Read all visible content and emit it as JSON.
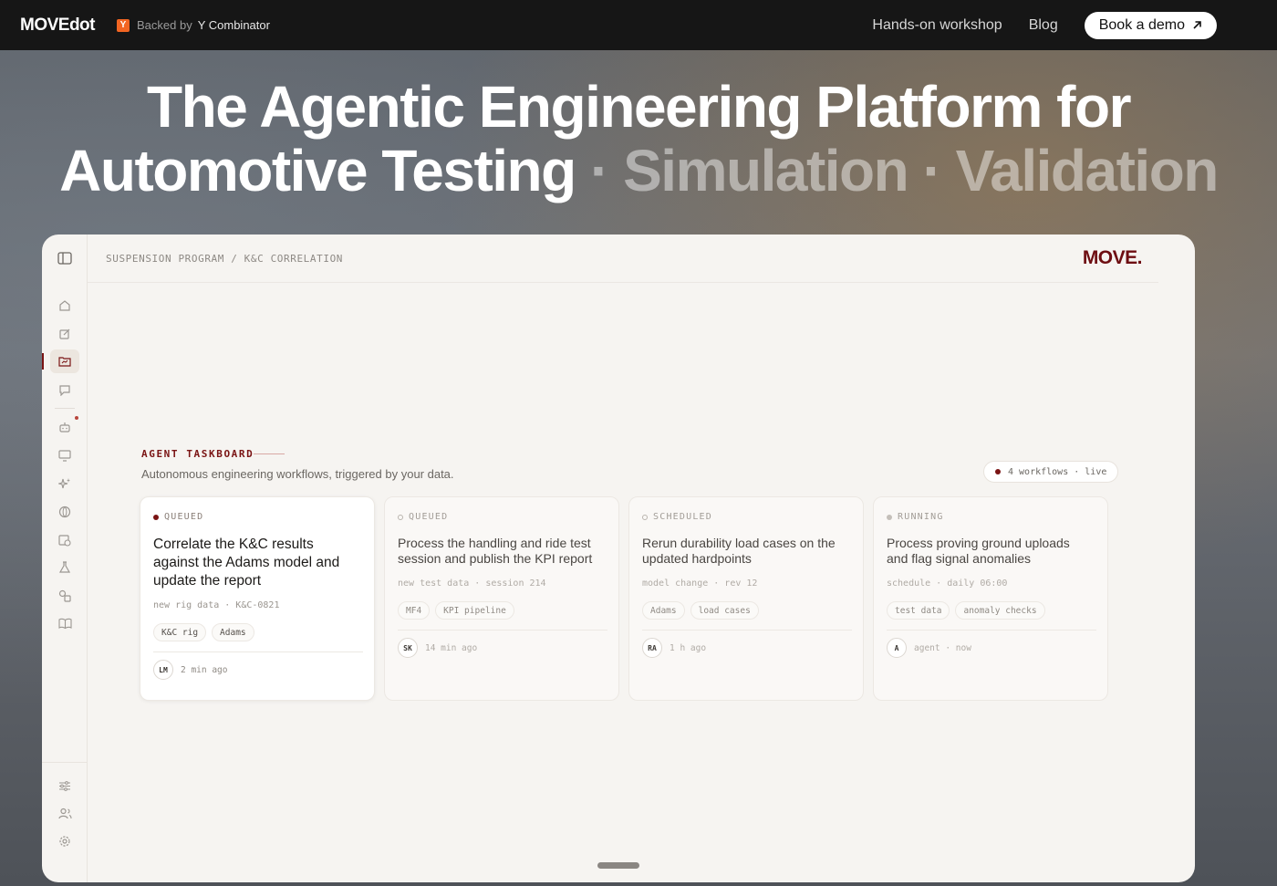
{
  "topbar": {
    "brand": "MOVEdot",
    "yc_letter": "Y",
    "backed_by": "Backed by",
    "yc_name": "Y Combinator",
    "links": [
      "Hands-on workshop",
      "Blog"
    ],
    "demo_label": "Book a demo",
    "demo_icon": "arrow-up-right-icon"
  },
  "hero": {
    "line1": "The Agentic Engineering Platform for",
    "line2_main": "Automotive Testing",
    "line2_sep1": " · ",
    "line2_dim1": "Simulation",
    "line2_sep2": " · ",
    "line2_dim2": "Validation"
  },
  "app": {
    "breadcrumb": "SUSPENSION PROGRAM / K&C CORRELATION",
    "logo": "MOVE.",
    "accent": "#7a1414",
    "taskboard": {
      "title": "AGENT TASKBOARD",
      "subtitle": "Autonomous engineering workflows, triggered by your data.",
      "live_pill": "4 workflows · live"
    },
    "cards": [
      {
        "status": "QUEUED",
        "task": "Correlate the K&C results against the Adams model and update the report",
        "meta": "new rig data · K&C-0821",
        "tags": [
          "K&C rig",
          "Adams"
        ],
        "avatar": "LM",
        "time": "2 min ago"
      },
      {
        "status": "QUEUED",
        "task": "Process the handling and ride test session and publish the KPI report",
        "meta": "new test data · session 214",
        "tags": [
          "MF4",
          "KPI pipeline"
        ],
        "avatar": "SK",
        "time": "14 min ago"
      },
      {
        "status": "SCHEDULED",
        "task": "Rerun durability load cases on the updated hardpoints",
        "meta": "model change · rev 12",
        "tags": [
          "Adams",
          "load cases"
        ],
        "avatar": "RA",
        "time": "1 h ago"
      },
      {
        "status": "RUNNING",
        "task": "Process proving ground uploads and flag signal anomalies",
        "meta": "schedule · daily 06:00",
        "tags": [
          "test data",
          "anomaly checks"
        ],
        "avatar": "A",
        "time": "agent · now"
      }
    ]
  }
}
